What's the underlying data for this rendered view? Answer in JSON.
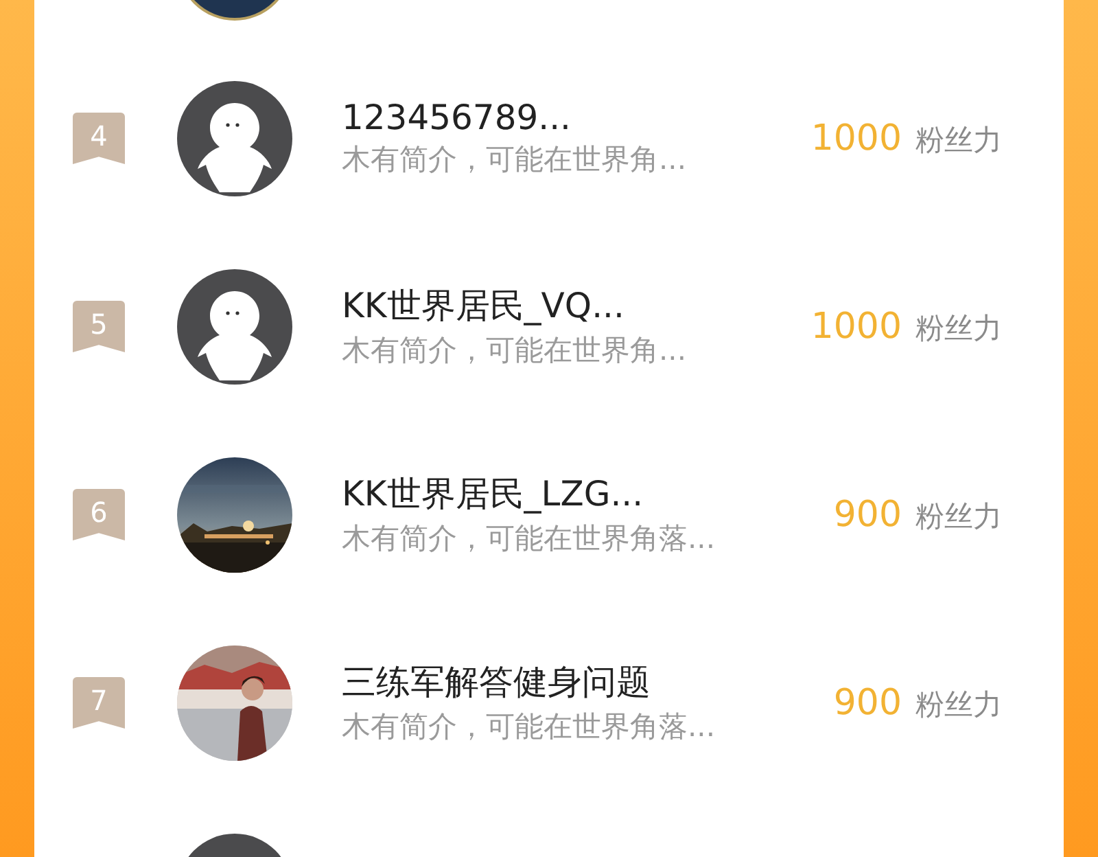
{
  "ranking": [
    {
      "rank": "4",
      "avatar": {
        "kind": "default"
      },
      "name": "123456789...",
      "bio": "木有简介，可能在世界角...",
      "score": "1000",
      "score_label": "粉丝力"
    },
    {
      "rank": "5",
      "avatar": {
        "kind": "default"
      },
      "name": "KK世界居民_VQ...",
      "bio": "木有简介，可能在世界角...",
      "score": "1000",
      "score_label": "粉丝力"
    },
    {
      "rank": "6",
      "name": "KK世界居民_LZG...",
      "bio": "木有简介，可能在世界角落...",
      "score": "900",
      "score_label": "粉丝力"
    },
    {
      "rank": "7",
      "name": "三练军解答健身问题",
      "bio": "木有简介，可能在世界角落...",
      "score": "900",
      "score_label": "粉丝力"
    }
  ]
}
